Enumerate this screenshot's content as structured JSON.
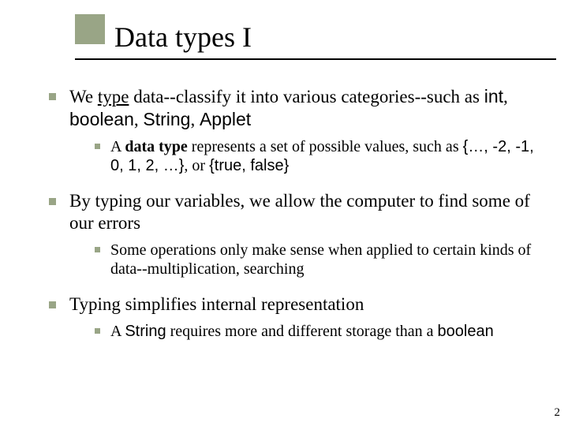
{
  "title": "Data types I",
  "bullets": {
    "b1": {
      "pre": "We ",
      "type_word": "type",
      "mid": " data--classify it into various categories--such as ",
      "c1": "int",
      "c2": "boolean",
      "c3": "String",
      "c4": "Applet",
      "sub": {
        "pre": "A ",
        "bold": "data type",
        "mid": " represents a set of possible values, such as ",
        "set1_open": "{…, ",
        "v1": "-2",
        "v2": "-1",
        "v3": "0",
        "v4": "1",
        "v5": "2",
        "set1_close": ", …}",
        "or": ", or ",
        "set2_open": "{",
        "t1": "true",
        "t2": "false",
        "set2_close": "}"
      }
    },
    "b2": {
      "text": "By typing our variables, we allow the computer to find some of our errors",
      "sub": {
        "text": "Some operations only make sense when applied to certain kinds of data--multiplication, searching"
      }
    },
    "b3": {
      "text": "Typing simplifies internal representation",
      "sub": {
        "pre": "A ",
        "c1": "String",
        "mid": " requires more and different storage than a ",
        "c2": "boolean"
      }
    }
  },
  "page_number": "2"
}
